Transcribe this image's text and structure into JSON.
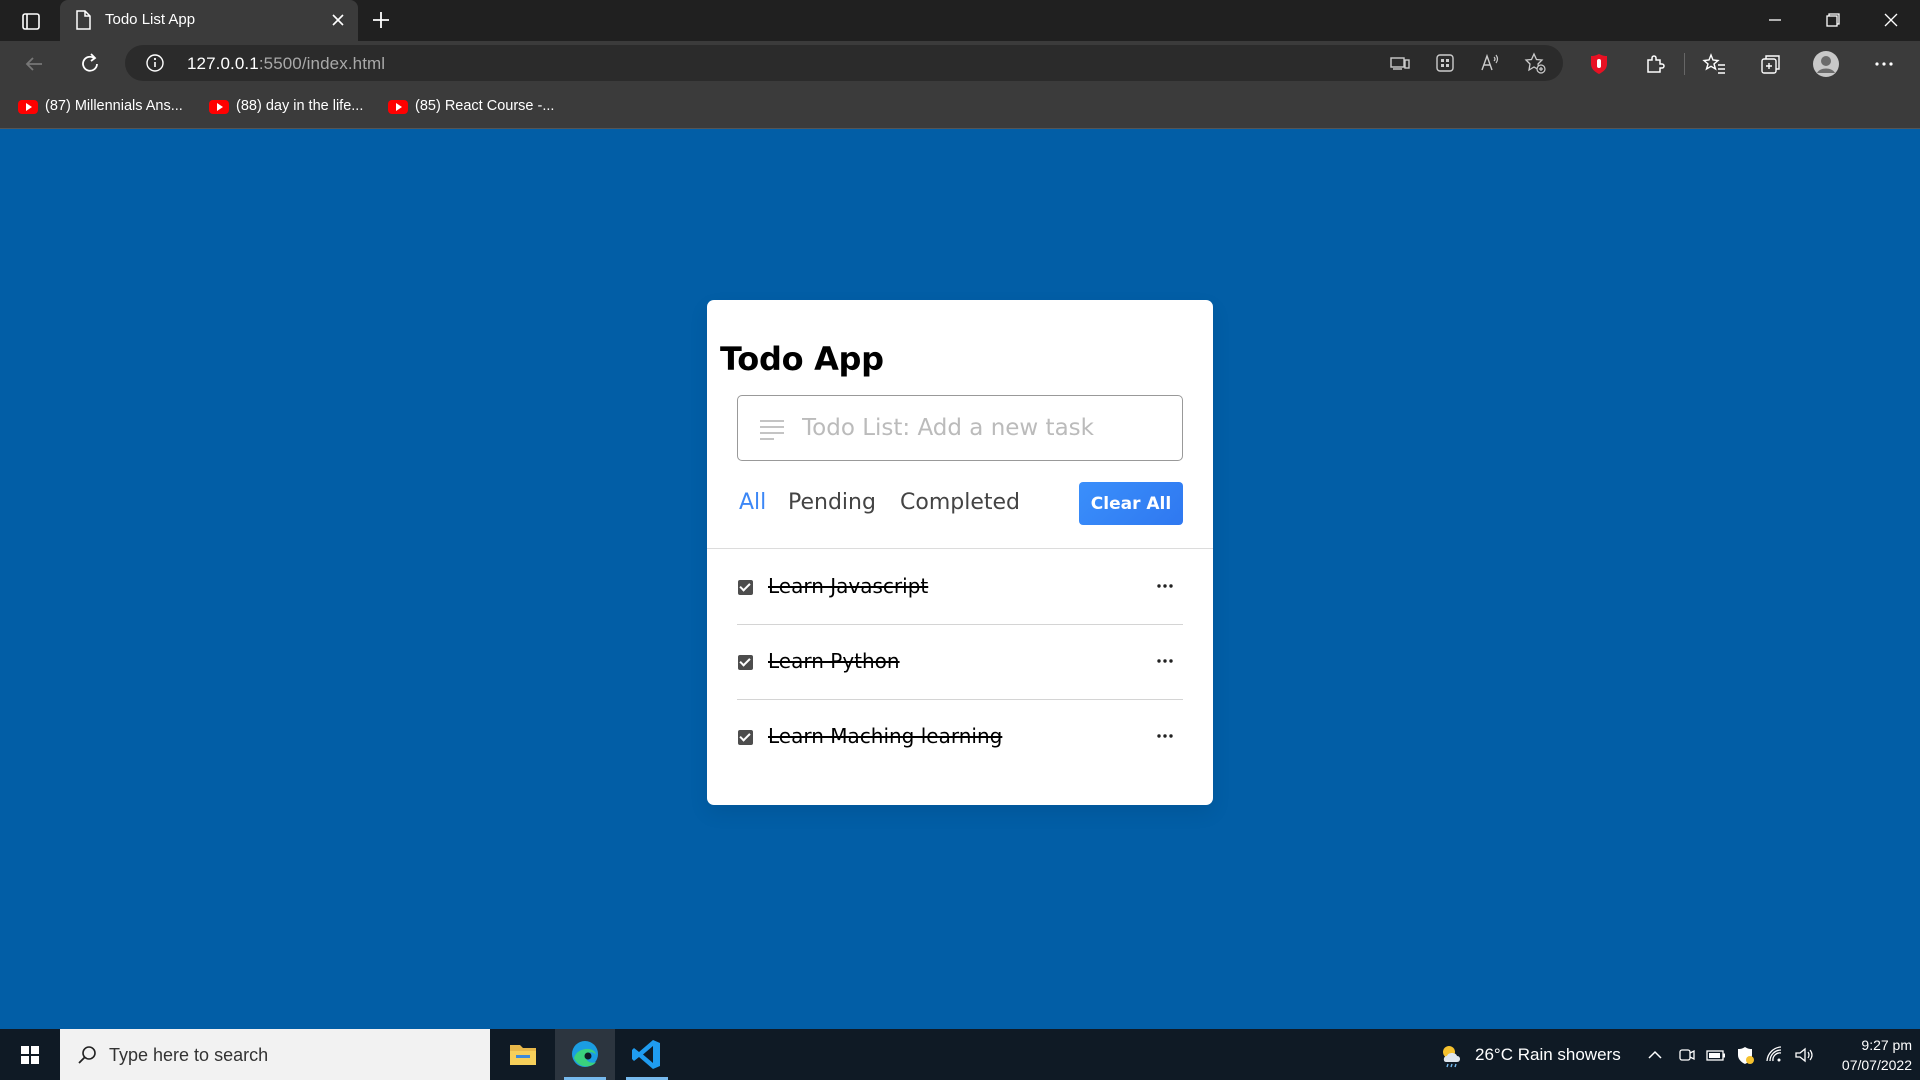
{
  "browser": {
    "tab_title": "Todo List App",
    "url_host": "127.0.0.1",
    "url_rest": ":5500/index.html",
    "bookmarks": [
      {
        "label": "(87) Millennials Ans..."
      },
      {
        "label": "(88) day in the life..."
      },
      {
        "label": "(85) React Course -..."
      }
    ]
  },
  "app": {
    "title": "Todo App",
    "input_placeholder": "Todo List: Add a new task",
    "input_value": "",
    "filters": [
      {
        "label": "All",
        "active": true
      },
      {
        "label": "Pending",
        "active": false
      },
      {
        "label": "Completed",
        "active": false
      }
    ],
    "clear_button": "Clear All",
    "tasks": [
      {
        "text": "Learn Javascript",
        "completed": true
      },
      {
        "text": "Learn Python",
        "completed": true
      },
      {
        "text": "Learn Maching learning",
        "completed": true
      }
    ]
  },
  "taskbar": {
    "search_placeholder": "Type here to search",
    "weather": "26°C  Rain showers",
    "time": "9:27 pm",
    "date": "07/07/2022"
  },
  "colors": {
    "page_background": "#025ea6",
    "accent": "#3c87f6",
    "clear_button": "#3a8ffb"
  },
  "icons": [
    "tab-actions-icon",
    "page-icon",
    "close-icon",
    "plus-icon",
    "minimize-icon",
    "restore-icon",
    "back-icon",
    "reload-icon",
    "info-icon",
    "youtube-icon",
    "lines-icon",
    "checkbox-icon",
    "more-icon",
    "windows-icon",
    "search-icon",
    "file-explorer-icon",
    "edge-icon",
    "vscode-icon",
    "weather-icon"
  ]
}
